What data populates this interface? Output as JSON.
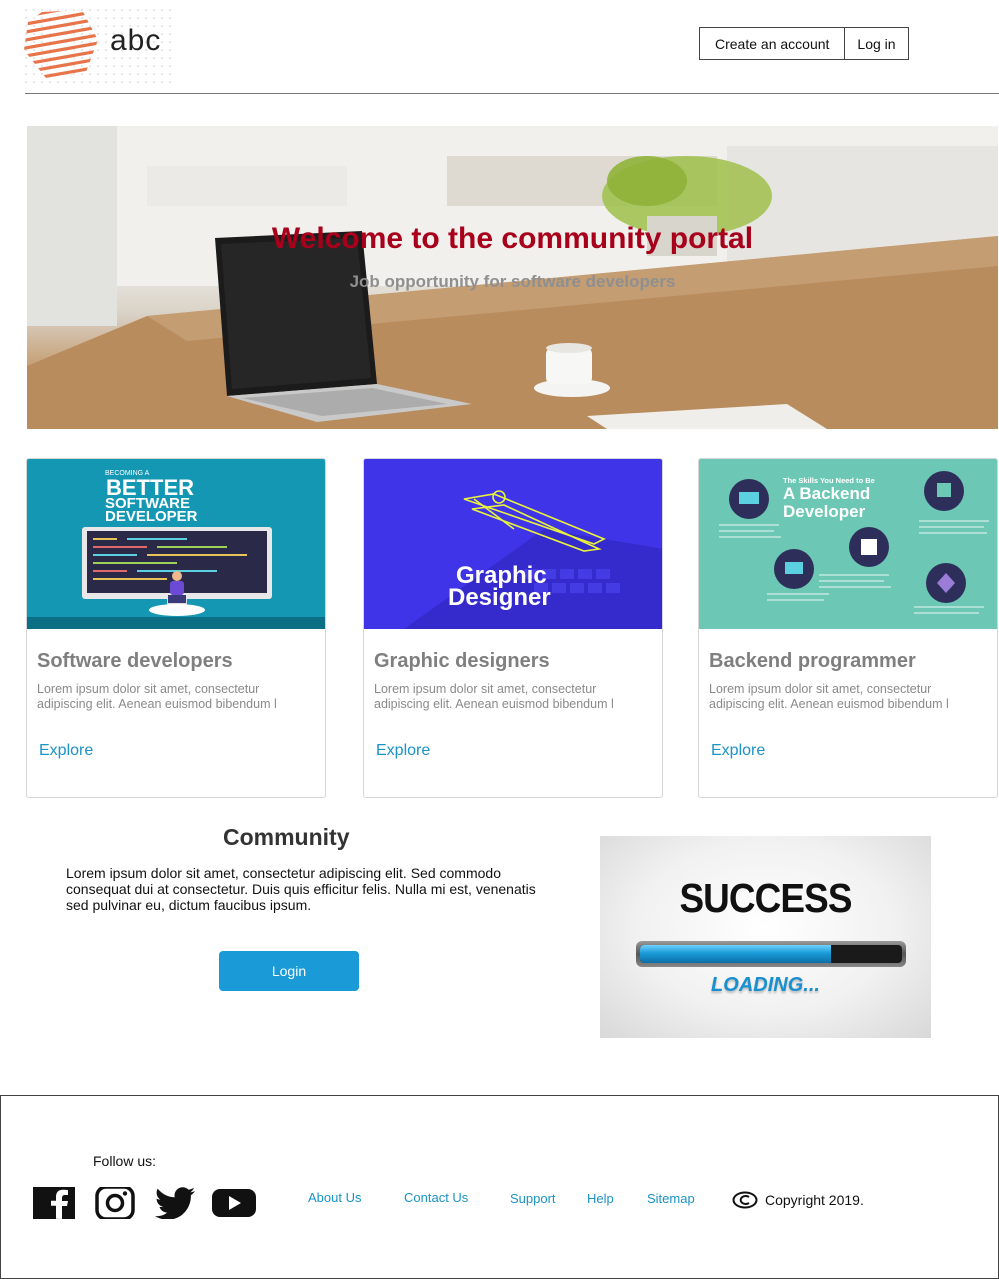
{
  "header": {
    "logo_text": "abc",
    "create_account_label": "Create an account",
    "login_label": "Log in"
  },
  "hero": {
    "title": "Welcome to the community portal",
    "subtitle": "Job opportunity for software developers"
  },
  "cards": [
    {
      "title": "Software developers",
      "text": "Lorem ipsum dolor sit amet, consectetur adipiscing elit. Aenean euismod bibendum l",
      "link": "Explore",
      "image": {
        "lines": [
          "BECOMING A",
          "BETTER",
          "SOFTWARE",
          "DEVELOPER"
        ],
        "bg": "#1497b2"
      }
    },
    {
      "title": "Graphic designers",
      "text": "Lorem ipsum dolor sit amet, consectetur adipiscing elit. Aenean euismod bibendum l",
      "link": "Explore",
      "image": {
        "lines": [
          "Graphic",
          "Designer"
        ],
        "bg": "#3f34e8"
      }
    },
    {
      "title": "Backend programmer",
      "text": "Lorem ipsum dolor sit amet, consectetur adipiscing elit. Aenean euismod bibendum l",
      "link": "Explore",
      "image": {
        "lines": [
          "The Skills You Need to Be",
          "A Backend",
          "Developer"
        ],
        "bg": "#6cc7b4"
      }
    }
  ],
  "community": {
    "title": "Community",
    "text": "Lorem ipsum dolor sit amet, consectetur adipiscing elit. Sed commodo consequat dui at consectetur. Duis quis efficitur felis. Nulla mi est, venenatis sed pulvinar eu, dictum faucibus ipsum.",
    "login_label": "Login",
    "image": {
      "headline": "SUCCESS",
      "caption": "LOADING...",
      "progress_fraction": 0.73
    }
  },
  "footer": {
    "follow_label": "Follow us:",
    "social": [
      "facebook-icon",
      "instagram-icon",
      "twitter-icon",
      "youtube-icon"
    ],
    "links": [
      "About Us",
      "Contact Us",
      "Support",
      "Help",
      "Sitemap"
    ],
    "copyright": "Copyright 2019."
  },
  "colors": {
    "accent": "#1a9bd7",
    "link": "#1a93c7",
    "hero_title": "#a8001b",
    "logo": "#e8744a"
  }
}
